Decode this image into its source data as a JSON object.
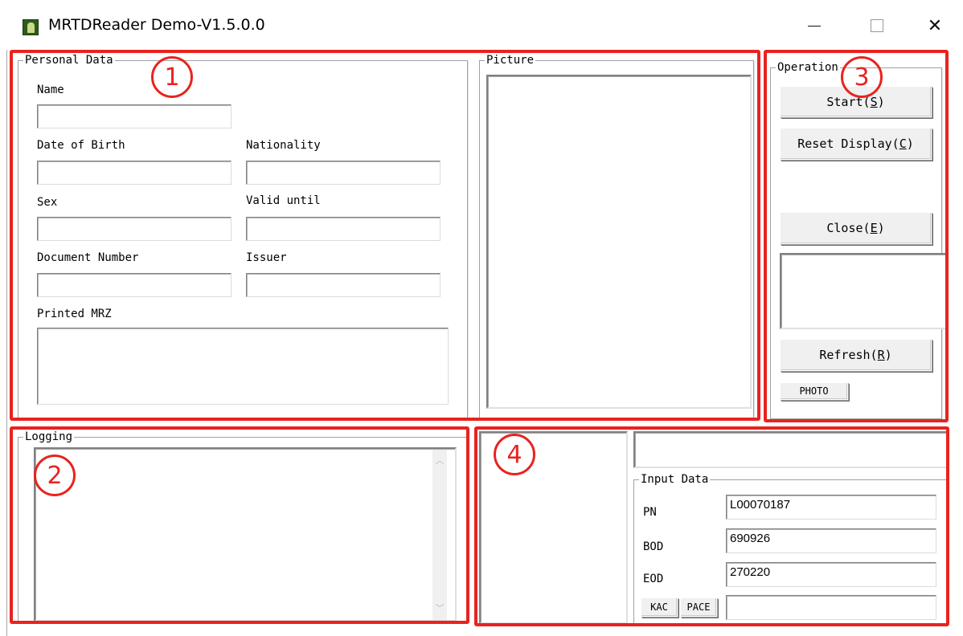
{
  "window": {
    "title": "MRTDReader Demo-V1.5.0.0",
    "controls": {
      "minimize": "—",
      "maximize": "☐",
      "close": "✕"
    }
  },
  "personal_data": {
    "group_title": "Personal Data",
    "fields": {
      "name": {
        "label": "Name",
        "value": ""
      },
      "date_of_birth": {
        "label": "Date of Birth",
        "value": ""
      },
      "nationality": {
        "label": "Nationality",
        "value": ""
      },
      "sex": {
        "label": "Sex",
        "value": ""
      },
      "valid_until": {
        "label": "Valid until",
        "value": ""
      },
      "document_number": {
        "label": "Document Number",
        "value": ""
      },
      "issuer": {
        "label": "Issuer",
        "value": ""
      },
      "printed_mrz": {
        "label": "Printed MRZ",
        "value": ""
      }
    }
  },
  "picture": {
    "group_title": "Picture"
  },
  "operation": {
    "group_title": "Operation",
    "buttons": {
      "start": {
        "text": "Start(",
        "mnemonic": "S",
        "end": ")"
      },
      "reset_display": {
        "text": "Reset Display(",
        "mnemonic": "C",
        "end": ")"
      },
      "close": {
        "text": "Close(",
        "mnemonic": "E",
        "end": ")"
      },
      "refresh": {
        "text": "Refresh(",
        "mnemonic": "R",
        "end": ")"
      },
      "photo": "PHOTO"
    }
  },
  "logging": {
    "group_title": "Logging",
    "content": ""
  },
  "input_data": {
    "group_title": "Input Data",
    "pn": {
      "label": "PN",
      "value": "L00070187"
    },
    "bod": {
      "label": "BOD",
      "value": "690926"
    },
    "eod": {
      "label": "EOD",
      "value": "270220"
    },
    "kac_button": "KAC",
    "pace_button": "PACE",
    "extra_value": ""
  },
  "annotations": {
    "colors": {
      "accent": "#e8231f"
    },
    "markers": [
      "1",
      "2",
      "3",
      "4"
    ]
  }
}
